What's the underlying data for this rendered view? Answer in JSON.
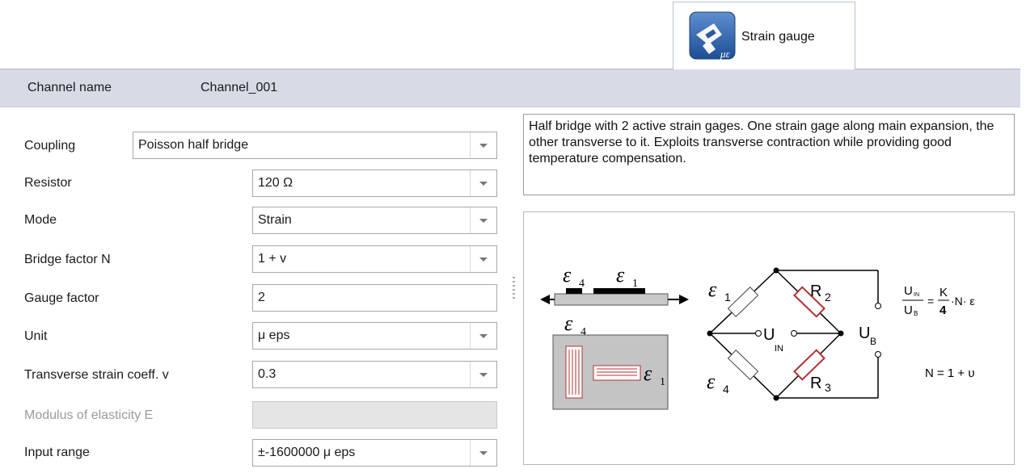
{
  "tab": {
    "label": "Strain gauge",
    "icon": "strain-gauge-icon"
  },
  "header": {
    "label": "Channel name",
    "value": "Channel_001"
  },
  "form": {
    "coupling": {
      "label": "Coupling",
      "value": "Poisson half bridge"
    },
    "resistor": {
      "label": "Resistor",
      "value": "120 Ω"
    },
    "mode": {
      "label": "Mode",
      "value": "Strain"
    },
    "bridge_factor": {
      "label": "Bridge factor N",
      "value": "1 + v"
    },
    "gauge_factor": {
      "label": "Gauge factor",
      "value": "2"
    },
    "unit": {
      "label": "Unit",
      "value": "μ eps"
    },
    "transverse": {
      "label": "Transverse strain coeff. v",
      "value": "0.3"
    },
    "modulus": {
      "label": "Modulus of elasticity E",
      "value": ""
    },
    "input_range": {
      "label": "Input range",
      "value": "±-1600000 μ eps"
    }
  },
  "description": "Half bridge with 2 active strain gages. One strain gage along main expansion, the other transverse to it. Exploits transverse contraction while providing good temperature compensation.",
  "diagram": {
    "eps4": "ε",
    "sub4": "4",
    "eps1": "ε",
    "sub1": "1",
    "r2": "R",
    "r2sub": "2",
    "r3": "R",
    "r3sub": "3",
    "uin": "U",
    "uinsub": "IN",
    "ub": "U",
    "ubsub": "B",
    "formula_num": "U",
    "formula_num_sub": "IN",
    "formula_den": "U",
    "formula_den_sub": "B",
    "formula_k": "K",
    "formula_4": "4",
    "formula_rest": "·N· ε",
    "formula_eq": "=",
    "n_formula": "N = 1 + υ"
  },
  "colors": {
    "header_bg": "#d6dbe6",
    "gauge_red": "#b03030",
    "icon_blue": "#2a5aa0"
  }
}
